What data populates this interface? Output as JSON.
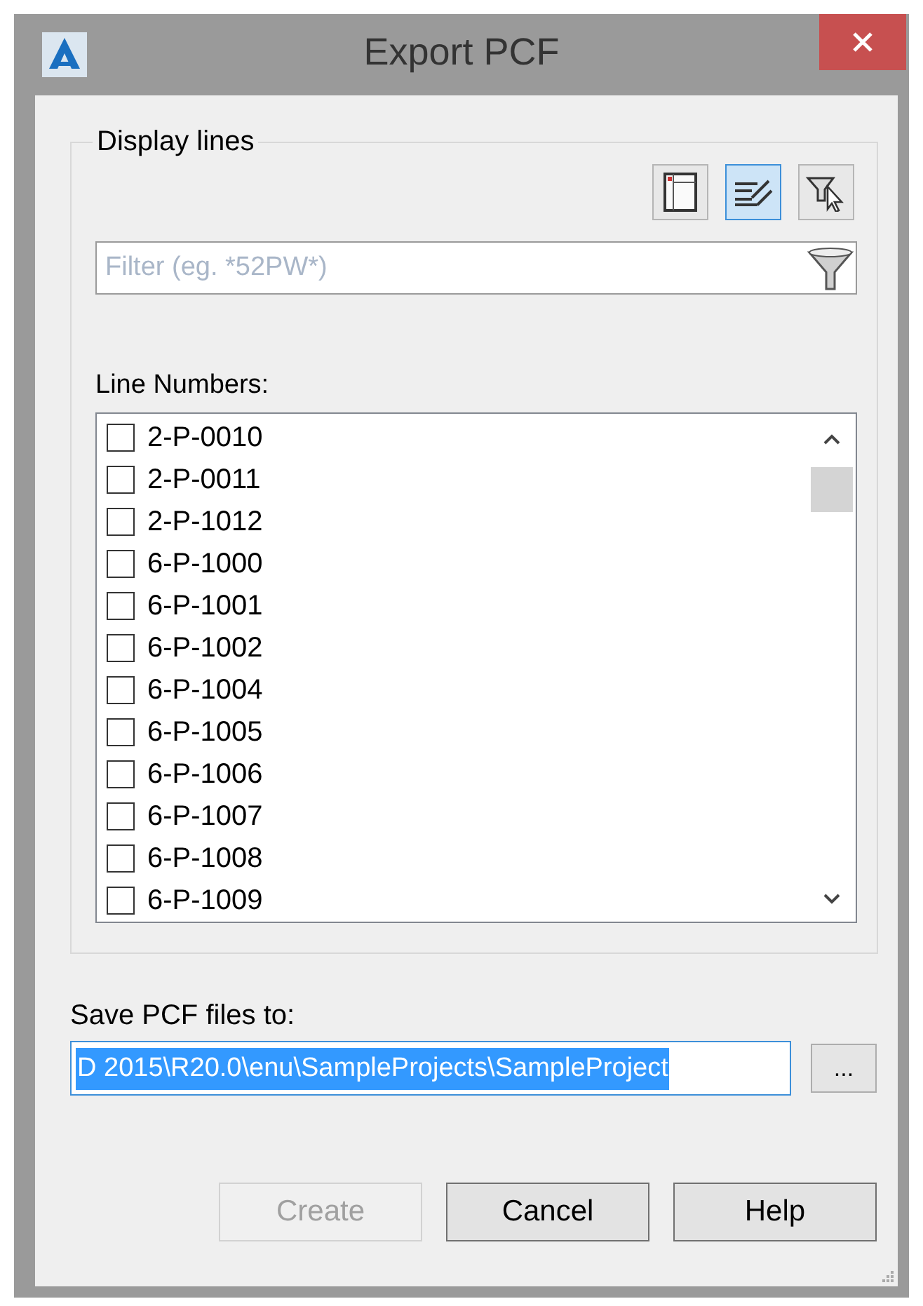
{
  "window": {
    "title": "Export PCF"
  },
  "display_lines": {
    "label": "Display lines",
    "toolbar": [
      {
        "kind": "columns",
        "selected": false
      },
      {
        "kind": "lines",
        "selected": true
      },
      {
        "kind": "filter-select",
        "selected": false
      }
    ],
    "filter": {
      "placeholder": "Filter (eg. *52PW*)"
    },
    "list_label": "Line Numbers:",
    "lines": [
      {
        "name": "2-P-0010",
        "checked": false
      },
      {
        "name": "2-P-0011",
        "checked": false
      },
      {
        "name": "2-P-1012",
        "checked": false
      },
      {
        "name": "6-P-1000",
        "checked": false
      },
      {
        "name": "6-P-1001",
        "checked": false
      },
      {
        "name": "6-P-1002",
        "checked": false
      },
      {
        "name": "6-P-1004",
        "checked": false
      },
      {
        "name": "6-P-1005",
        "checked": false
      },
      {
        "name": "6-P-1006",
        "checked": false
      },
      {
        "name": "6-P-1007",
        "checked": false
      },
      {
        "name": "6-P-1008",
        "checked": false
      },
      {
        "name": "6-P-1009",
        "checked": false
      }
    ]
  },
  "save": {
    "label": "Save PCF files to:",
    "value": "D 2015\\R20.0\\enu\\SampleProjects\\SampleProject",
    "browse": "..."
  },
  "buttons": [
    {
      "label": "Create",
      "disabled": true
    },
    {
      "label": "Cancel",
      "disabled": false
    },
    {
      "label": "Help",
      "disabled": false
    }
  ]
}
